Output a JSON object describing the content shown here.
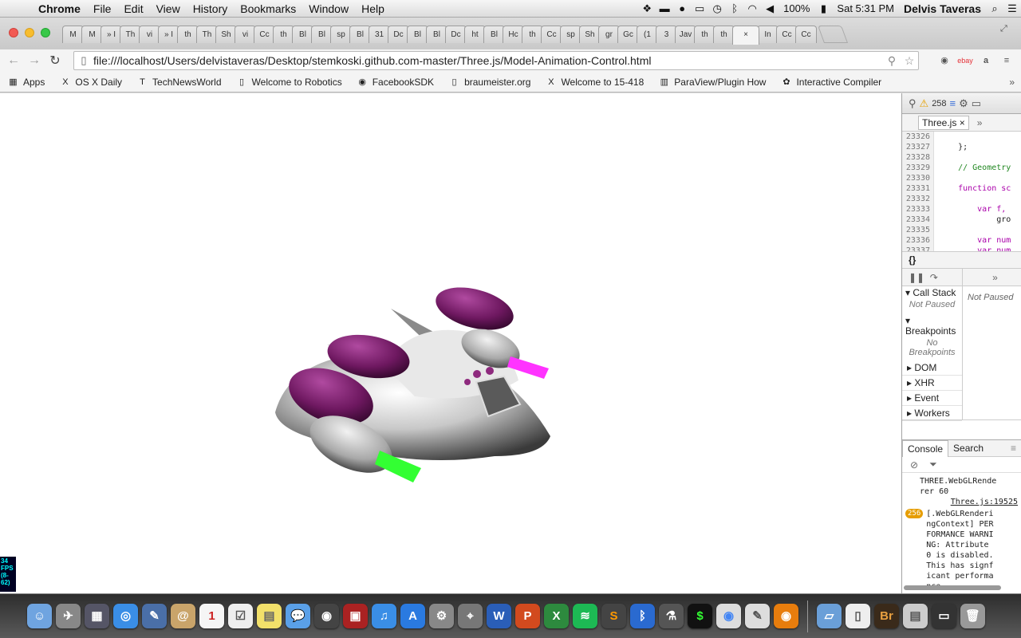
{
  "menubar": {
    "app": "Chrome",
    "items": [
      "File",
      "Edit",
      "View",
      "History",
      "Bookmarks",
      "Window",
      "Help"
    ],
    "battery": "100%",
    "clock": "Sat 5:31 PM",
    "user": "Delvis Taveras"
  },
  "tabs": [
    "M",
    "M",
    "» I",
    "Th",
    "vi",
    "» I",
    "th",
    "Th",
    "Sh",
    "vi",
    "Cc",
    "th",
    "Bl",
    "Bl",
    "sp",
    "Bl",
    "31",
    "Dc",
    "Bl",
    "Bl",
    "Dc",
    "ht",
    "Bl",
    "Hc",
    "th",
    "Cc",
    "sp",
    "Sh",
    "gr",
    "Gc",
    "(1",
    "3",
    "Jav",
    "th",
    "th",
    "",
    "In",
    "Cc",
    "Cc"
  ],
  "active_tab_close": "×",
  "omnibox": {
    "url": "file:///localhost/Users/delvistaveras/Desktop/stemkoski.github.com-master/Three.js/Model-Animation-Control.html"
  },
  "bookmarks": [
    {
      "label": "Apps",
      "icon": "apps-grid-icon"
    },
    {
      "label": "OS X Daily",
      "icon": "x-logo-icon"
    },
    {
      "label": "TechNewsWorld",
      "icon": "t-logo-icon"
    },
    {
      "label": "Welcome to Robotics",
      "icon": "page-icon"
    },
    {
      "label": "FacebookSDK",
      "icon": "github-icon"
    },
    {
      "label": "braumeister.org",
      "icon": "page-icon"
    },
    {
      "label": "Welcome to 15-418",
      "icon": "x-logo-icon"
    },
    {
      "label": "ParaView/Plugin How",
      "icon": "paraview-icon"
    },
    {
      "label": "Interactive Compiler",
      "icon": "compiler-icon"
    }
  ],
  "fps": [
    "34",
    "FPS",
    "(8-",
    "62)"
  ],
  "devtools": {
    "warnings": "258",
    "file_tab": "Three.js",
    "line_numbers": [
      "23326",
      "23327",
      "23328",
      "23329",
      "23330",
      "23331",
      "23332",
      "23333",
      "23334",
      "23335",
      "23336",
      "23337"
    ],
    "code_lines": [
      "",
      "    };",
      "",
      "    // Geometry",
      "",
      "    function sc",
      "",
      "        var f,",
      "            gro",
      "",
      "        var num",
      "        var num"
    ],
    "pretty_print": "{}",
    "call_stack": "Call Stack",
    "call_stack_status": "Not Paused",
    "breakpoints": "Breakpoints",
    "breakpoints_status": "No Breakpoints",
    "not_paused": "Not Paused",
    "sections": [
      "DOM",
      "XHR",
      "Event",
      "Workers"
    ],
    "console_tab": "Console",
    "search_tab": "Search",
    "log_renderer": "THREE.WebGLRenderer 60",
    "log_link": "Three.js:19525",
    "log_badge": "256",
    "log_warning": "[.WebGLRenderingContext] PERFORMANCE WARNING: Attribute 0 is disabled. This has signficant performance"
  },
  "colors": {
    "hull": "#d9d9d9",
    "engine": "#7a1a6a",
    "thruster_magenta": "#ff33ff",
    "thruster_green": "#33ff33"
  }
}
